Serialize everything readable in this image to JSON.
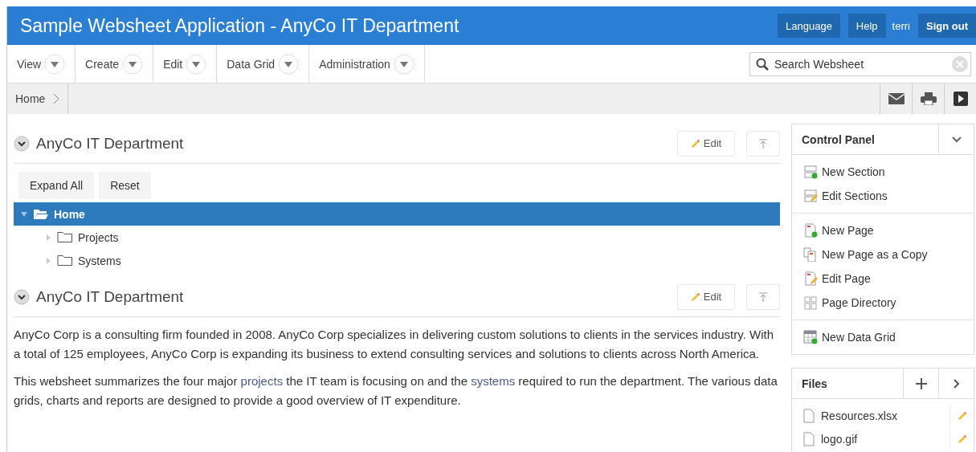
{
  "header": {
    "title": "Sample Websheet Application - AnyCo IT Department",
    "buttons": [
      "Language",
      "Help"
    ],
    "user": "terri",
    "sign_out": "Sign out"
  },
  "menus": [
    "View",
    "Create",
    "Edit",
    "Data Grid",
    "Administration"
  ],
  "search": {
    "placeholder": "Search Websheet"
  },
  "breadcrumb": [
    "Home"
  ],
  "sections": [
    {
      "kind": "tree",
      "title": "AnyCo IT Department",
      "edit": "Edit",
      "buttons": [
        "Expand All",
        "Reset"
      ],
      "tree": [
        {
          "label": "Home",
          "selected": true,
          "expanded": true,
          "children": [
            {
              "label": "Projects",
              "selected": false,
              "expanded": false
            },
            {
              "label": "Systems",
              "selected": false,
              "expanded": false
            }
          ]
        }
      ]
    },
    {
      "kind": "text",
      "title": "AnyCo IT Department",
      "edit": "Edit",
      "paragraphs": [
        [
          {
            "kind": "text",
            "text": "AnyCo Corp is a consulting firm founded in 2008. AnyCo Corp specializes in delivering custom solutions to clients in the services industry. With a total of 125 employees, AnyCo Corp is expanding its business to extend consulting services and solutions to clients across North America."
          }
        ],
        [
          {
            "kind": "text",
            "text": "This websheet summarizes the four major "
          },
          {
            "kind": "link",
            "text": "projects"
          },
          {
            "kind": "text",
            "text": " the IT team is focusing on and the "
          },
          {
            "kind": "link",
            "text": "systems"
          },
          {
            "kind": "text",
            "text": " required to run the department. The various data grids, charts and reports are designed to provide a good overview of IT expenditure."
          }
        ]
      ]
    }
  ],
  "control_panel": {
    "title": "Control Panel",
    "groups": [
      [
        {
          "kind": "section-add",
          "label": "New Section"
        },
        {
          "kind": "section-edit",
          "label": "Edit Sections"
        }
      ],
      [
        {
          "kind": "page-add",
          "label": "New Page"
        },
        {
          "kind": "page-copy",
          "label": "New Page as a Copy"
        },
        {
          "kind": "page-edit",
          "label": "Edit Page"
        },
        {
          "kind": "directory",
          "label": "Page Directory"
        }
      ],
      [
        {
          "kind": "grid-add",
          "label": "New Data Grid"
        }
      ]
    ]
  },
  "files": {
    "title": "Files",
    "items": [
      "Resources.xlsx",
      "logo.gif"
    ]
  }
}
